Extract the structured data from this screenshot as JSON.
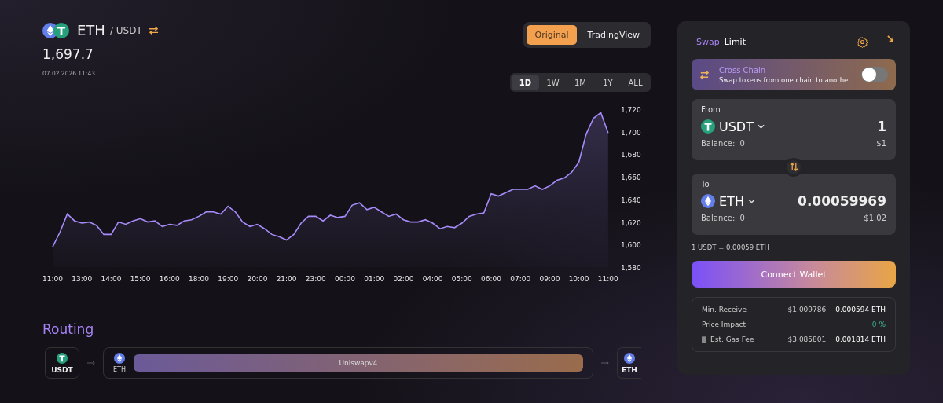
{
  "pair": {
    "base": "ETH",
    "quote": "/ USDT",
    "icons": [
      {
        "kind": "ether"
      },
      {
        "kind": "tether"
      }
    ]
  },
  "price": "1,697.7",
  "timestamp": "07 02 2026 11:43",
  "view_toggle": [
    {
      "label": "Original",
      "selected": true
    },
    {
      "label": "TradingView",
      "selected": false
    }
  ],
  "ranges": [
    {
      "label": "1D",
      "selected": true
    },
    {
      "label": "1W",
      "selected": false
    },
    {
      "label": "1M",
      "selected": false
    },
    {
      "label": "1Y",
      "selected": false
    },
    {
      "label": "ALL",
      "selected": false
    }
  ],
  "chart": {
    "chart_data": {
      "type": "area",
      "ylim": [
        1580,
        1720
      ],
      "yticks": [
        {
          "value": 1580,
          "label": "1,580"
        },
        {
          "value": 1600,
          "label": "1,600"
        },
        {
          "value": 1620,
          "label": "1,620"
        },
        {
          "value": 1640,
          "label": "1,640"
        },
        {
          "value": 1660,
          "label": "1,660"
        },
        {
          "value": 1680,
          "label": "1,680"
        },
        {
          "value": 1700,
          "label": "1,700"
        },
        {
          "value": 1720,
          "label": "1,720"
        }
      ],
      "categories": [
        "11:00",
        null,
        null,
        null,
        "13:00",
        null,
        null,
        null,
        "14:00",
        null,
        null,
        null,
        "15:00",
        null,
        null,
        null,
        "16:00",
        null,
        null,
        null,
        "18:00",
        null,
        null,
        null,
        "19:00",
        null,
        null,
        null,
        "20:00",
        null,
        null,
        null,
        "21:00",
        null,
        null,
        null,
        "23:00",
        null,
        null,
        null,
        "00:00",
        null,
        null,
        null,
        "01:00",
        null,
        null,
        null,
        "02:00",
        null,
        null,
        null,
        "04:00",
        null,
        null,
        null,
        "05:00",
        null,
        null,
        null,
        "06:00",
        null,
        null,
        null,
        "07:00",
        null,
        null,
        null,
        "09:00",
        null,
        null,
        null,
        "10:00",
        null,
        null,
        null,
        "11:00"
      ],
      "series": [
        {
          "color": "#a78bfa",
          "values": [
            1598,
            1611,
            1627,
            1621,
            1619,
            1620,
            1617,
            1609,
            1609,
            1620,
            1618,
            1621,
            1623,
            1620,
            1621,
            1616,
            1618,
            1617,
            1621,
            1622,
            1625,
            1629,
            1629,
            1627,
            1634,
            1629,
            1620,
            1616,
            1618,
            1614,
            1609,
            1607,
            1604,
            1609,
            1619,
            1625,
            1625,
            1621,
            1626,
            1624,
            1625,
            1635,
            1637,
            1631,
            1633,
            1629,
            1625,
            1627,
            1622,
            1620,
            1620,
            1622,
            1619,
            1614,
            1616,
            1615,
            1619,
            1625,
            1627,
            1628,
            1645,
            1643,
            1646,
            1649,
            1649,
            1649,
            1652,
            1649,
            1652,
            1657,
            1659,
            1664,
            1673,
            1698,
            1712,
            1717,
            1699
          ]
        }
      ]
    }
  },
  "routing": {
    "title": "Routing",
    "start": {
      "token": "USDT",
      "kind": "tether"
    },
    "hop": {
      "token": "ETH",
      "kind": "ether",
      "pool": "Uniswapv4"
    },
    "end": {
      "token": "ETH",
      "kind": "ether"
    }
  },
  "swap": {
    "tabs": [
      {
        "label": "Swap",
        "selected": true
      },
      {
        "label": "Limit",
        "selected": false
      }
    ],
    "cross_chain": {
      "title": "Cross Chain",
      "subtitle": "Swap tokens from one chain to another",
      "on": false
    },
    "from": {
      "label": "From",
      "token": "USDT",
      "kind": "tether",
      "amount": "1",
      "balance_label": "Balance:",
      "balance": "0",
      "value": "$1"
    },
    "to": {
      "label": "To",
      "token": "ETH",
      "kind": "ether",
      "amount": "0.00059969",
      "balance_label": "Balance:",
      "balance": "0",
      "value": "$1.02"
    },
    "rate": "1 USDT = 0.00059 ETH",
    "connect_button": "Connect Wallet",
    "details": [
      {
        "kind": "pair",
        "label": "Min. Receive",
        "usd": "$1.009786",
        "amount": "0.000594 ETH"
      },
      {
        "kind": "percent",
        "label": "Price Impact",
        "amount": "0 %"
      },
      {
        "kind": "gas",
        "label": "Est. Gas Fee",
        "usd": "$3.085801",
        "amount": "0.001814 ETH"
      }
    ]
  }
}
